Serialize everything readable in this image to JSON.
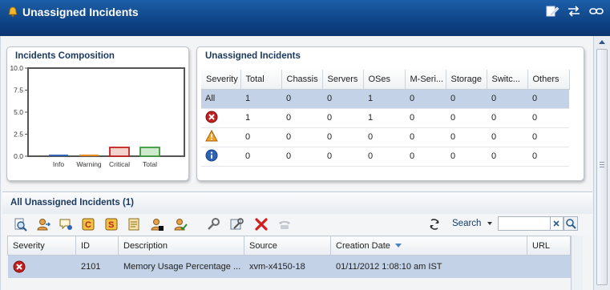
{
  "window": {
    "title": "Unassigned Incidents"
  },
  "chart_panel": {
    "title": "Incidents Composition"
  },
  "chart_data": {
    "type": "bar",
    "title": "Incidents Composition",
    "categories": [
      "Info",
      "Warning",
      "Critical",
      "Total"
    ],
    "values": [
      0,
      0,
      1,
      1
    ],
    "colors": [
      "#2f63b8",
      "#e08a1e",
      "#c22020",
      "#3c9a3c"
    ],
    "ylim": [
      0,
      10
    ],
    "yticks": [
      "10.0",
      "7.5",
      "5.0",
      "2.5",
      "0.0"
    ],
    "xlabel": "",
    "ylabel": "",
    "grid": false
  },
  "summary": {
    "title": "Unassigned Incidents",
    "columns": [
      "Severity",
      "Total",
      "Chassis",
      "Servers",
      "OSes",
      "M-Seri...",
      "Storage",
      "Switc...",
      "Others"
    ],
    "rows": [
      {
        "severity_label": "All",
        "severity_icon": "",
        "values": [
          "1",
          "0",
          "0",
          "1",
          "0",
          "0",
          "0",
          "0"
        ]
      },
      {
        "severity_label": "",
        "severity_icon": "critical-icon",
        "values": [
          "1",
          "0",
          "0",
          "1",
          "0",
          "0",
          "0",
          "0"
        ]
      },
      {
        "severity_label": "",
        "severity_icon": "warning-icon",
        "values": [
          "0",
          "0",
          "0",
          "0",
          "0",
          "0",
          "0",
          "0"
        ]
      },
      {
        "severity_label": "",
        "severity_icon": "info-icon",
        "values": [
          "0",
          "0",
          "0",
          "0",
          "0",
          "0",
          "0",
          "0"
        ]
      }
    ]
  },
  "list": {
    "title": "All Unassigned Incidents (1)",
    "search_label": "Search",
    "search_value": "",
    "columns": [
      "Severity",
      "ID",
      "Description",
      "Source",
      "Creation Date",
      "URL"
    ],
    "rows": [
      {
        "severity_icon": "critical-icon",
        "id": "2101",
        "description": "Memory Usage Percentage ...",
        "source": "xvm-x4150-18",
        "creation_date": "01/11/2012 1:08:10 am IST",
        "url": ""
      }
    ]
  },
  "toolbar_icons": [
    "view-details-icon",
    "assign-icon",
    "comment-icon",
    "suggested-action-icon",
    "run-action-icon",
    "annotation-icon",
    "acknowledge-icon",
    "mark-repaired-icon",
    "repair-icon",
    "settings-icon",
    "delete-icon",
    "escalate-icon",
    "refresh-icon"
  ],
  "colors": {
    "titlebar": "#0d3f80",
    "selected_row": "#c3d2e6",
    "critical": "#c22020",
    "warning": "#e08a1e",
    "info": "#2f63b8"
  }
}
